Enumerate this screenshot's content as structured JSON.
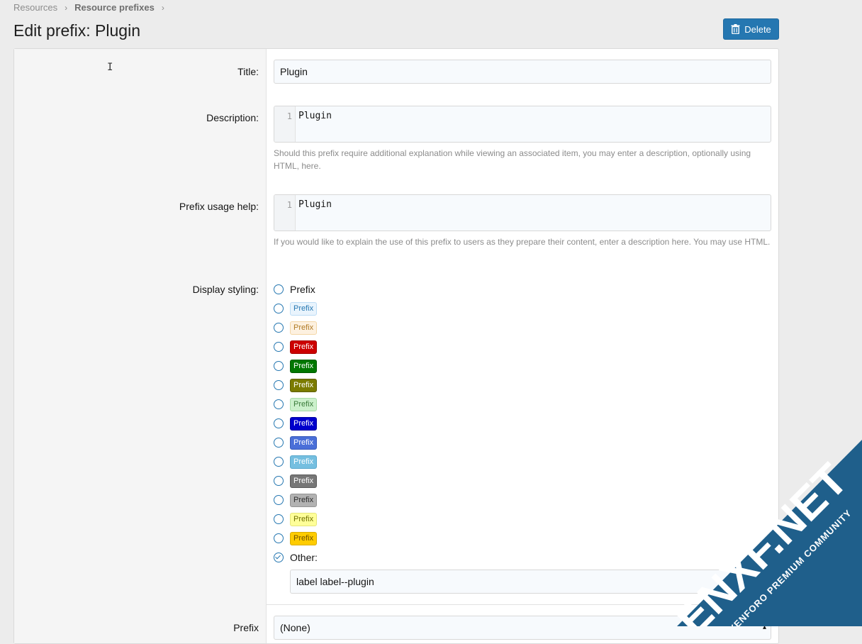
{
  "breadcrumb": {
    "items": [
      "Resources",
      "Resource prefixes"
    ]
  },
  "page": {
    "title": "Edit prefix: Plugin"
  },
  "toolbar": {
    "delete_label": "Delete"
  },
  "form": {
    "title_label": "Title:",
    "title_value": "Plugin",
    "description_label": "Description:",
    "description_line_number": "1",
    "description_value": "Plugin",
    "description_hint": "Should this prefix require additional explanation while viewing an associated item, you may enter a description, optionally using HTML, here.",
    "usage_label": "Prefix usage help:",
    "usage_line_number": "1",
    "usage_value": "Plugin",
    "usage_hint": "If you would like to explain the use of this prefix to users as they prepare their content, enter a description here. You may use HTML.",
    "styling_label": "Display styling:",
    "styling_options": [
      {
        "text": "Prefix",
        "bg": "",
        "fg": "#141414",
        "border": ""
      },
      {
        "text": "Prefix",
        "bg": "#e9f4fd",
        "fg": "#2577b1",
        "border": "#bcdcf5"
      },
      {
        "text": "Prefix",
        "bg": "#fdf1e0",
        "fg": "#b07a24",
        "border": "#f3d7a6"
      },
      {
        "text": "Prefix",
        "bg": "#cc0000",
        "fg": "#ffffff",
        "border": "#a60000"
      },
      {
        "text": "Prefix",
        "bg": "#007700",
        "fg": "#ffffff",
        "border": "#005a00"
      },
      {
        "text": "Prefix",
        "bg": "#7b7b00",
        "fg": "#ffffff",
        "border": "#5e5e00"
      },
      {
        "text": "Prefix",
        "bg": "#ccf0cc",
        "fg": "#3a7a3a",
        "border": "#a8dca8"
      },
      {
        "text": "Prefix",
        "bg": "#0000cc",
        "fg": "#ffffff",
        "border": "#0000a0"
      },
      {
        "text": "Prefix",
        "bg": "#4a6fd8",
        "fg": "#ffffff",
        "border": "#3658b8"
      },
      {
        "text": "Prefix",
        "bg": "#75bfe0",
        "fg": "#ffffff",
        "border": "#59a8cc"
      },
      {
        "text": "Prefix",
        "bg": "#777777",
        "fg": "#ffffff",
        "border": "#5c5c5c"
      },
      {
        "text": "Prefix",
        "bg": "#b2b2b2",
        "fg": "#2e2e2e",
        "border": "#949494"
      },
      {
        "text": "Prefix",
        "bg": "#ffff99",
        "fg": "#6e6e00",
        "border": "#e6e67a"
      },
      {
        "text": "Prefix",
        "bg": "#ffcc00",
        "fg": "#6e5000",
        "border": "#d9ad00"
      }
    ],
    "other_label": "Other:",
    "other_value": "label label--plugin",
    "group_label": "Prefix",
    "group_value": "(None)"
  },
  "colors": {
    "accent": "#2577b1",
    "watermark": "#1f5f8b"
  },
  "watermark": {
    "brand": "ENXF.NET",
    "tagline": "XENFORO PREMIUM COMMUNITY"
  }
}
